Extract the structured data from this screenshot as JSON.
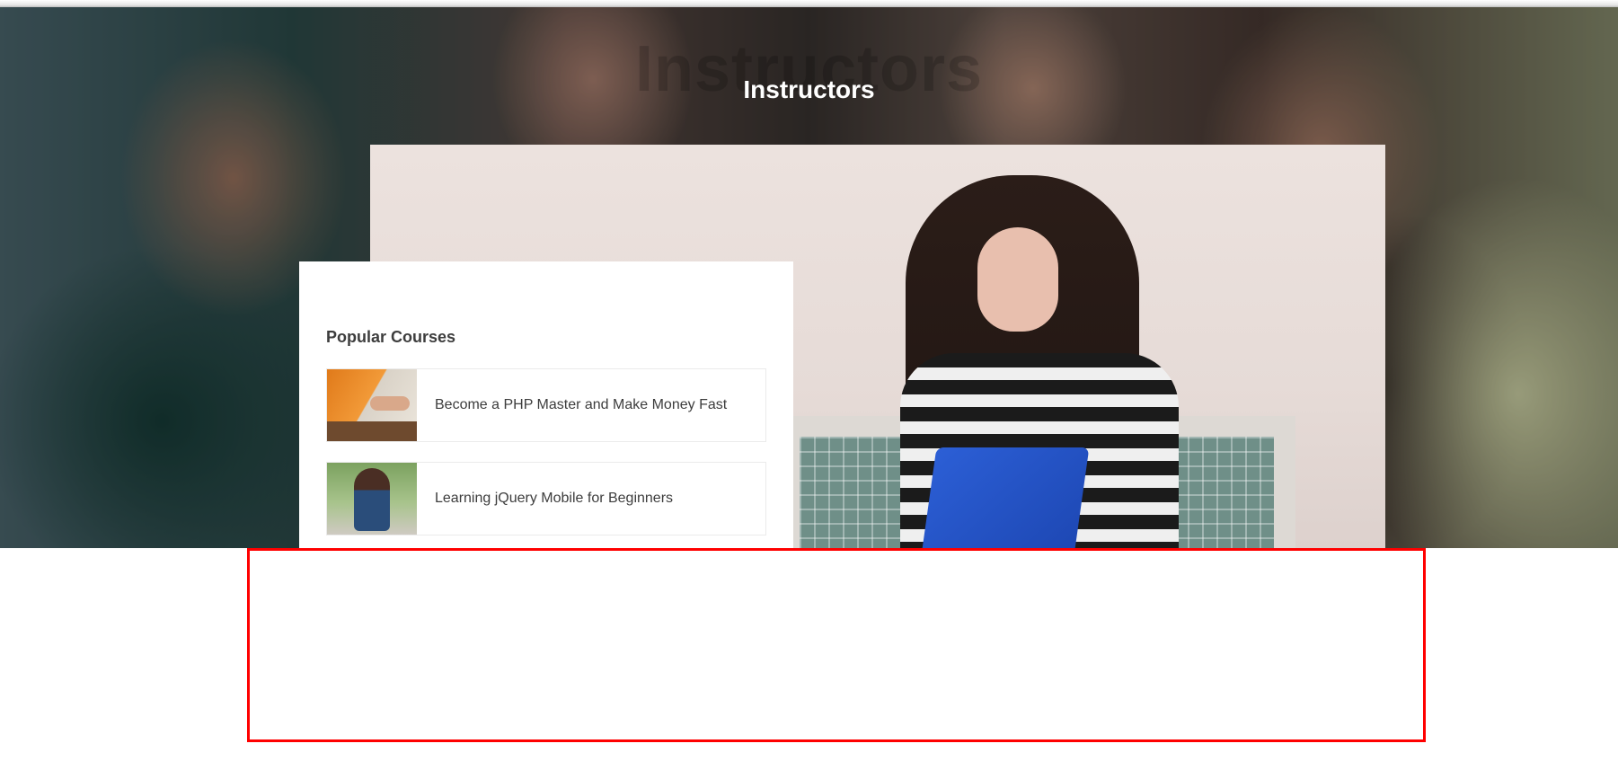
{
  "hero": {
    "ghost_text": "Instructors",
    "title": "Instructors"
  },
  "popular_courses": {
    "heading": "Popular Courses",
    "items": [
      {
        "title": "Become a PHP Master and Make Money Fast",
        "thumbnail": "php-course-thumbnail"
      },
      {
        "title": "Learning jQuery Mobile for Beginners",
        "thumbnail": "jquery-course-thumbnail"
      }
    ]
  },
  "colors": {
    "highlight_border": "#ff0000",
    "text": "#3d3d3d",
    "card_bg": "#ffffff"
  }
}
